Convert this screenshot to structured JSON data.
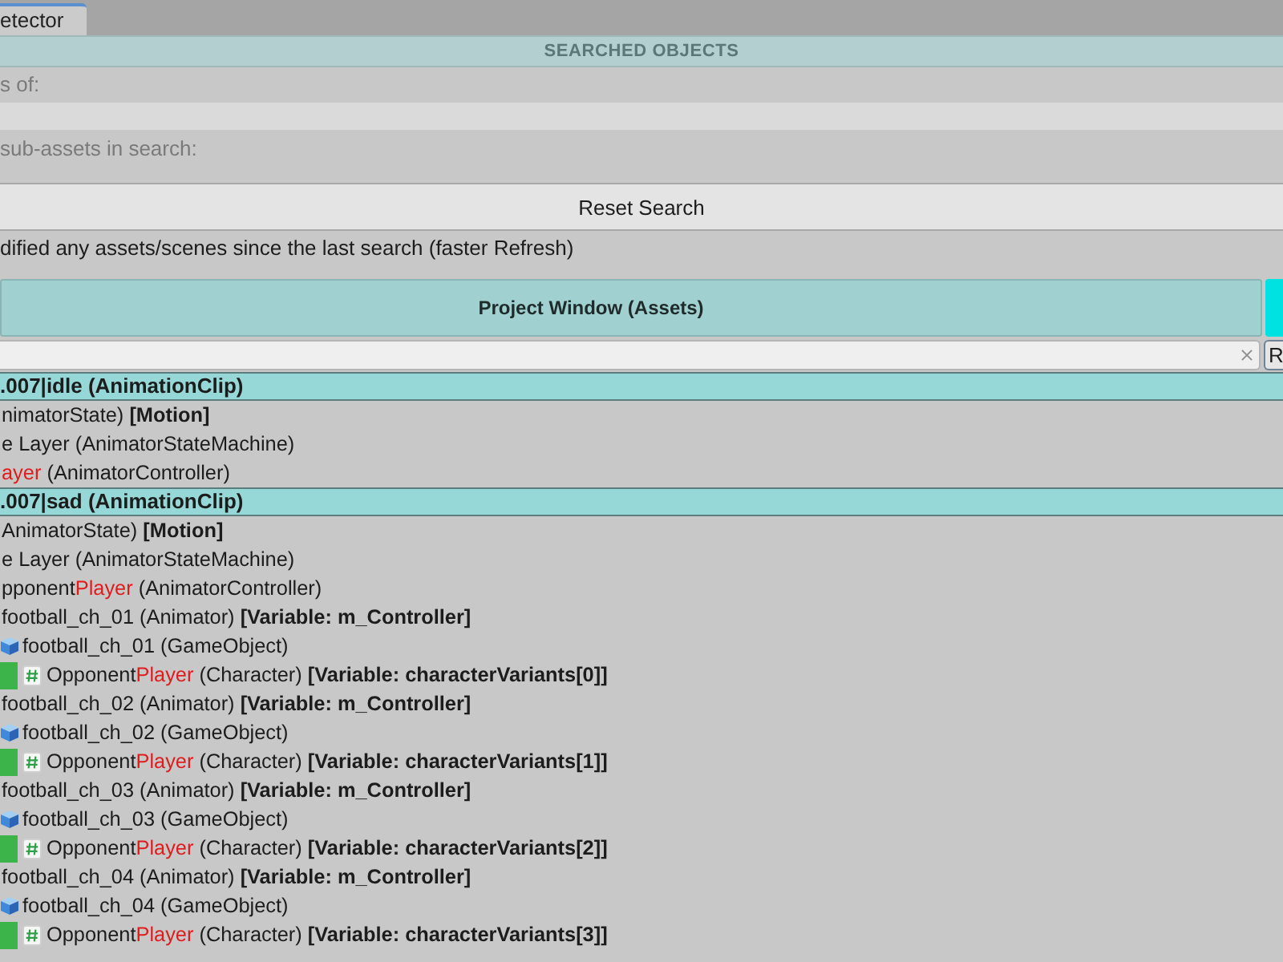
{
  "window": {
    "tab": "etector"
  },
  "panel": {
    "title": "SEARCHED OBJECTS",
    "rows": [
      {
        "kind": "label",
        "text": "s of:"
      },
      {
        "kind": "field"
      },
      {
        "kind": "label",
        "text": "sub-assets in search:"
      },
      {
        "kind": "button",
        "text": "Reset Search"
      },
      {
        "kind": "note",
        "text": "dified any assets/scenes since the last search (faster Refresh)"
      }
    ]
  },
  "group": {
    "title": "Project Window (Assets)"
  },
  "filter": {
    "button": "R"
  },
  "results": [
    {
      "title": ".007|idle (AnimationClip)",
      "children": [
        {
          "kind": "asset",
          "segments": [
            {
              "kind": "plain",
              "text": "nimatorState) "
            },
            {
              "kind": "bold",
              "text": "[Motion]"
            }
          ],
          "children": [
            {
              "kind": "asset",
              "segments": [
                {
                  "kind": "plain",
                  "text": "e Layer (AnimatorStateMachine)"
                }
              ],
              "children": [
                {
                  "kind": "asset",
                  "segments": [
                    {
                      "kind": "match",
                      "text": "ayer"
                    },
                    {
                      "kind": "plain",
                      "text": " (AnimatorController)"
                    }
                  ]
                }
              ]
            }
          ]
        }
      ]
    },
    {
      "title": ".007|sad (AnimationClip)",
      "children": [
        {
          "kind": "asset",
          "segments": [
            {
              "kind": "plain",
              "text": "AnimatorState) "
            },
            {
              "kind": "bold",
              "text": "[Motion]"
            }
          ],
          "children": [
            {
              "kind": "asset",
              "segments": [
                {
                  "kind": "plain",
                  "text": "e Layer (AnimatorStateMachine)"
                }
              ],
              "children": [
                {
                  "kind": "asset",
                  "segments": [
                    {
                      "kind": "plain",
                      "text": "pponent"
                    },
                    {
                      "kind": "match",
                      "text": "Player"
                    },
                    {
                      "kind": "plain",
                      "text": " (AnimatorController)"
                    }
                  ],
                  "children": [
                    {
                      "kind": "asset",
                      "segments": [
                        {
                          "kind": "plain",
                          "text": "football_ch_01 (Animator) "
                        },
                        {
                          "kind": "bold",
                          "text": "[Variable: m_Controller]"
                        }
                      ],
                      "children": [
                        {
                          "kind": "gameobject",
                          "segments": [
                            {
                              "kind": "plain",
                              "text": "football_ch_01 (GameObject)"
                            }
                          ],
                          "children": [
                            {
                              "kind": "script",
                              "segments": [
                                {
                                  "kind": "plain",
                                  "text": "Opponent"
                                },
                                {
                                  "kind": "match",
                                  "text": "Player"
                                },
                                {
                                  "kind": "plain",
                                  "text": " (Character) "
                                },
                                {
                                  "kind": "bold",
                                  "text": "[Variable: characterVariants[0]]"
                                }
                              ]
                            }
                          ]
                        }
                      ]
                    },
                    {
                      "kind": "asset",
                      "segments": [
                        {
                          "kind": "plain",
                          "text": "football_ch_02 (Animator) "
                        },
                        {
                          "kind": "bold",
                          "text": "[Variable: m_Controller]"
                        }
                      ],
                      "children": [
                        {
                          "kind": "gameobject",
                          "segments": [
                            {
                              "kind": "plain",
                              "text": "football_ch_02 (GameObject)"
                            }
                          ],
                          "children": [
                            {
                              "kind": "script",
                              "segments": [
                                {
                                  "kind": "plain",
                                  "text": "Opponent"
                                },
                                {
                                  "kind": "match",
                                  "text": "Player"
                                },
                                {
                                  "kind": "plain",
                                  "text": " (Character) "
                                },
                                {
                                  "kind": "bold",
                                  "text": "[Variable: characterVariants[1]]"
                                }
                              ]
                            }
                          ]
                        }
                      ]
                    },
                    {
                      "kind": "asset",
                      "segments": [
                        {
                          "kind": "plain",
                          "text": "football_ch_03 (Animator) "
                        },
                        {
                          "kind": "bold",
                          "text": "[Variable: m_Controller]"
                        }
                      ],
                      "children": [
                        {
                          "kind": "gameobject",
                          "segments": [
                            {
                              "kind": "plain",
                              "text": "football_ch_03 (GameObject)"
                            }
                          ],
                          "children": [
                            {
                              "kind": "script",
                              "segments": [
                                {
                                  "kind": "plain",
                                  "text": "Opponent"
                                },
                                {
                                  "kind": "match",
                                  "text": "Player"
                                },
                                {
                                  "kind": "plain",
                                  "text": " (Character) "
                                },
                                {
                                  "kind": "bold",
                                  "text": "[Variable: characterVariants[2]]"
                                }
                              ]
                            }
                          ]
                        }
                      ]
                    },
                    {
                      "kind": "asset",
                      "segments": [
                        {
                          "kind": "plain",
                          "text": "football_ch_04 (Animator) "
                        },
                        {
                          "kind": "bold",
                          "text": "[Variable: m_Controller]"
                        }
                      ],
                      "children": [
                        {
                          "kind": "gameobject",
                          "segments": [
                            {
                              "kind": "plain",
                              "text": "football_ch_04 (GameObject)"
                            }
                          ],
                          "children": [
                            {
                              "kind": "script",
                              "segments": [
                                {
                                  "kind": "plain",
                                  "text": "Opponent"
                                },
                                {
                                  "kind": "match",
                                  "text": "Player"
                                },
                                {
                                  "kind": "plain",
                                  "text": " (Character) "
                                },
                                {
                                  "kind": "bold",
                                  "text": "[Variable: characterVariants[3]]"
                                }
                              ]
                            }
                          ]
                        }
                      ]
                    }
                  ]
                }
              ]
            }
          ]
        }
      ]
    }
  ]
}
